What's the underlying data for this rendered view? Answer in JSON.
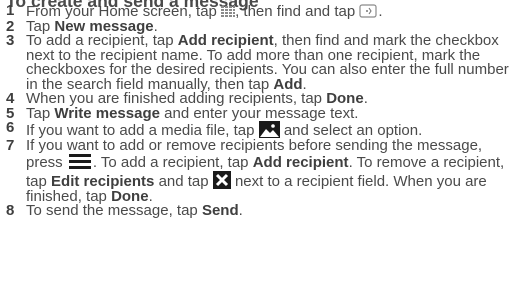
{
  "heading": "To create and send a message",
  "steps": [
    {
      "num": "1",
      "t1": "From your Home screen, tap",
      "t2": ", then find and tap",
      "t3": ".",
      "icons": [
        "apps-grid-icon",
        "messaging-icon"
      ]
    },
    {
      "num": "2",
      "t1": "Tap",
      "b1": "New message",
      "t2": "."
    },
    {
      "num": "3",
      "t1": "To add a recipient, tap",
      "b1": "Add recipient",
      "t2": ", then find and mark the checkbox next to the recipient name. To add more than one recipient, mark the checkboxes for the desired recipients. You can also enter the full number in the search field manually, then tap",
      "b2": "Add",
      "t3": "."
    },
    {
      "num": "4",
      "t1": "When you are finished adding recipients, tap",
      "b1": "Done",
      "t2": "."
    },
    {
      "num": "5",
      "t1": "Tap",
      "b1": "Write message",
      "t2": "and enter your message text."
    },
    {
      "num": "6",
      "t1": "If you want to add a media file, tap",
      "t2": "and select an option.",
      "icons": [
        "add-media-icon"
      ]
    },
    {
      "num": "7",
      "t1": "If you want to add or remove recipients before sending the message, press",
      "t2": ". To add a recipient, tap",
      "b1": "Add recipient",
      "t3": ". To remove a recipient, tap",
      "b2": "Edit recipients",
      "t4": "and tap",
      "t5": "next to a recipient field. When you are finished, tap",
      "b3": "Done",
      "t6": ".",
      "icons": [
        "menu-icon",
        "delete-icon"
      ]
    },
    {
      "num": "8",
      "t1": "To send the message, tap",
      "b1": "Send",
      "t2": "."
    }
  ],
  "colors": {
    "text": "#4a4a4a",
    "bold_text": "#3f3f3f",
    "icon_dark": "#1a1a1a",
    "icon_gray": "#8a8a8a"
  }
}
